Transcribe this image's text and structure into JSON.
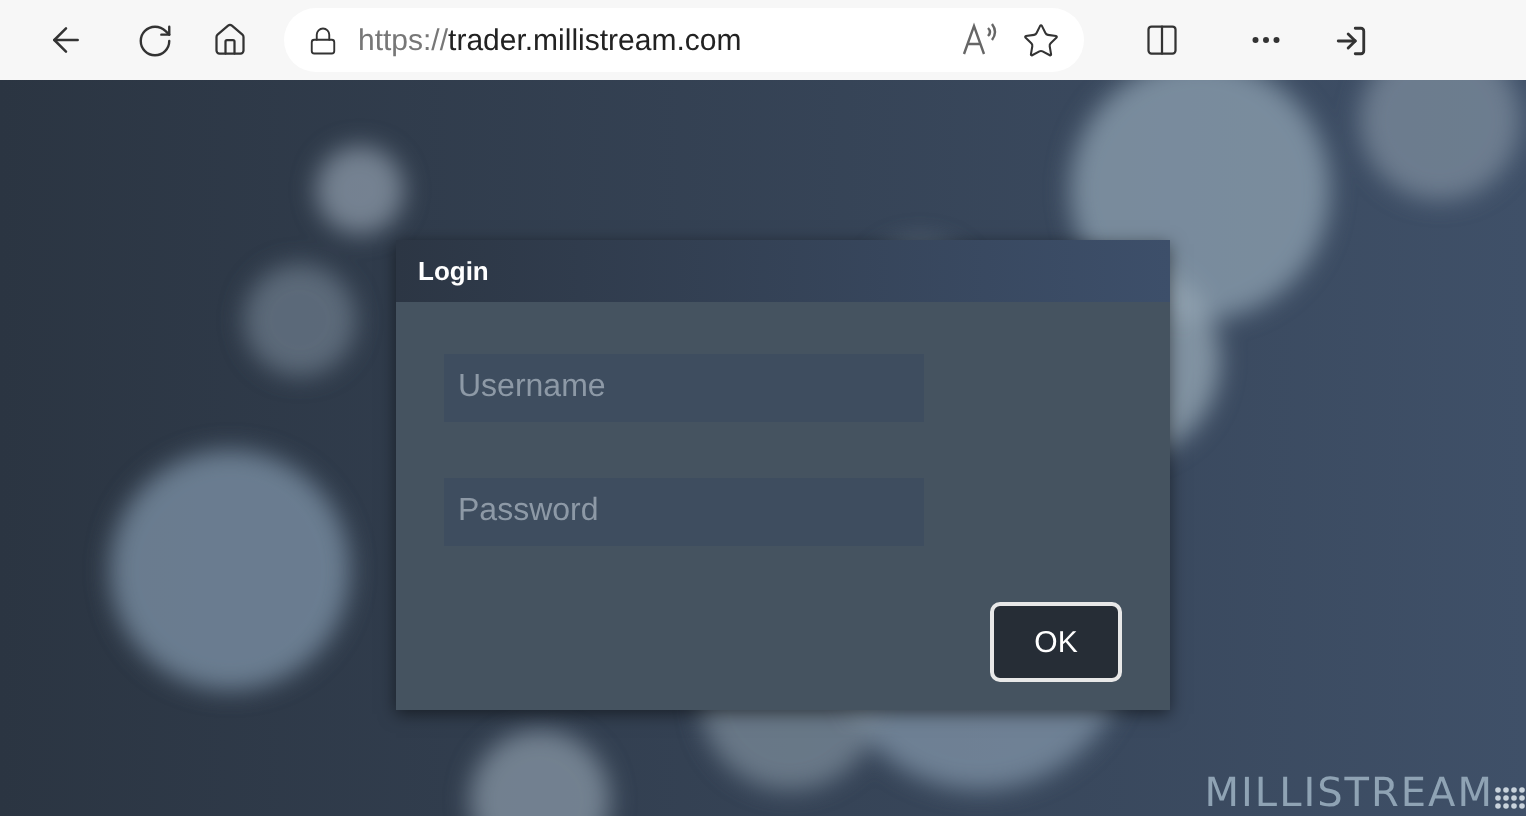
{
  "browser": {
    "url_prefix": "https://",
    "url_host": "trader.millistream.com"
  },
  "dialog": {
    "title": "Login",
    "fields": [
      {
        "placeholder": "Username"
      },
      {
        "placeholder": "Password"
      }
    ],
    "button": "OK"
  },
  "logo": {
    "text": "MILLISTREAM"
  }
}
